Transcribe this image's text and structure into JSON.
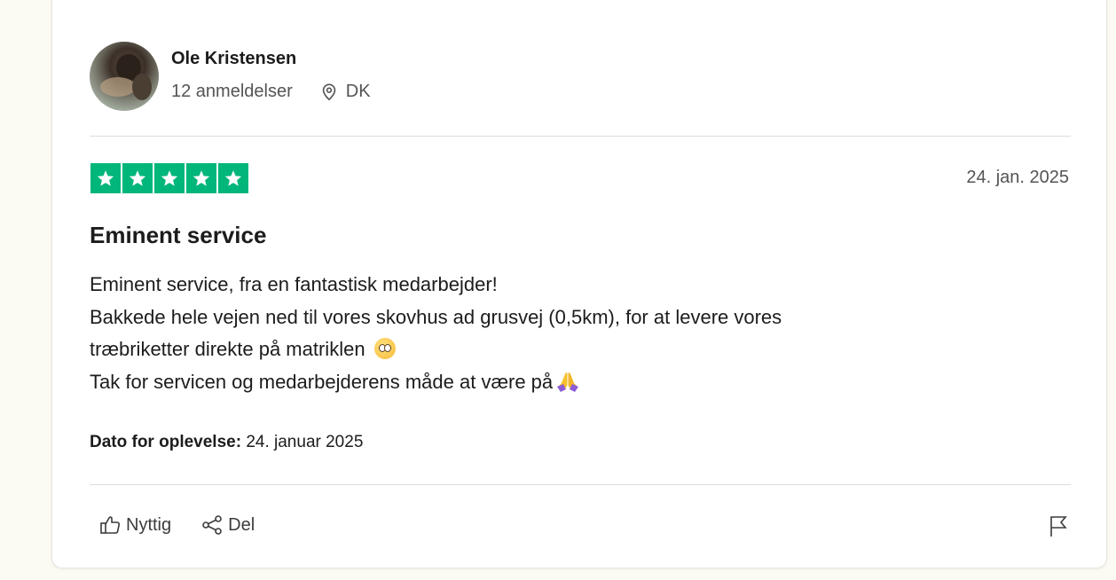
{
  "reviewer": {
    "name": "Ole Kristensen",
    "review_count": "12 anmeldelser",
    "country": "DK"
  },
  "review": {
    "rating": 5,
    "rating_color": "#00b67a",
    "date": "24. jan. 2025",
    "title": "Eminent service",
    "body_lines": [
      "Eminent service, fra en fantastisk medarbejder!",
      "Bakkede hele vejen ned til vores skovhus ad grusvej (0,5km), for at levere vores",
      "træbriketter direkte på matriklen",
      "Tak for servicen og medarbejderens måde at være på"
    ],
    "experience_label": "Dato for oplevelse:",
    "experience_date": "24. januar 2025"
  },
  "actions": {
    "useful_label": "Nyttig",
    "share_label": "Del"
  },
  "icons": {
    "location": "location-pin-icon",
    "useful": "thumbs-up-icon",
    "share": "share-icon",
    "flag": "flag-icon"
  }
}
